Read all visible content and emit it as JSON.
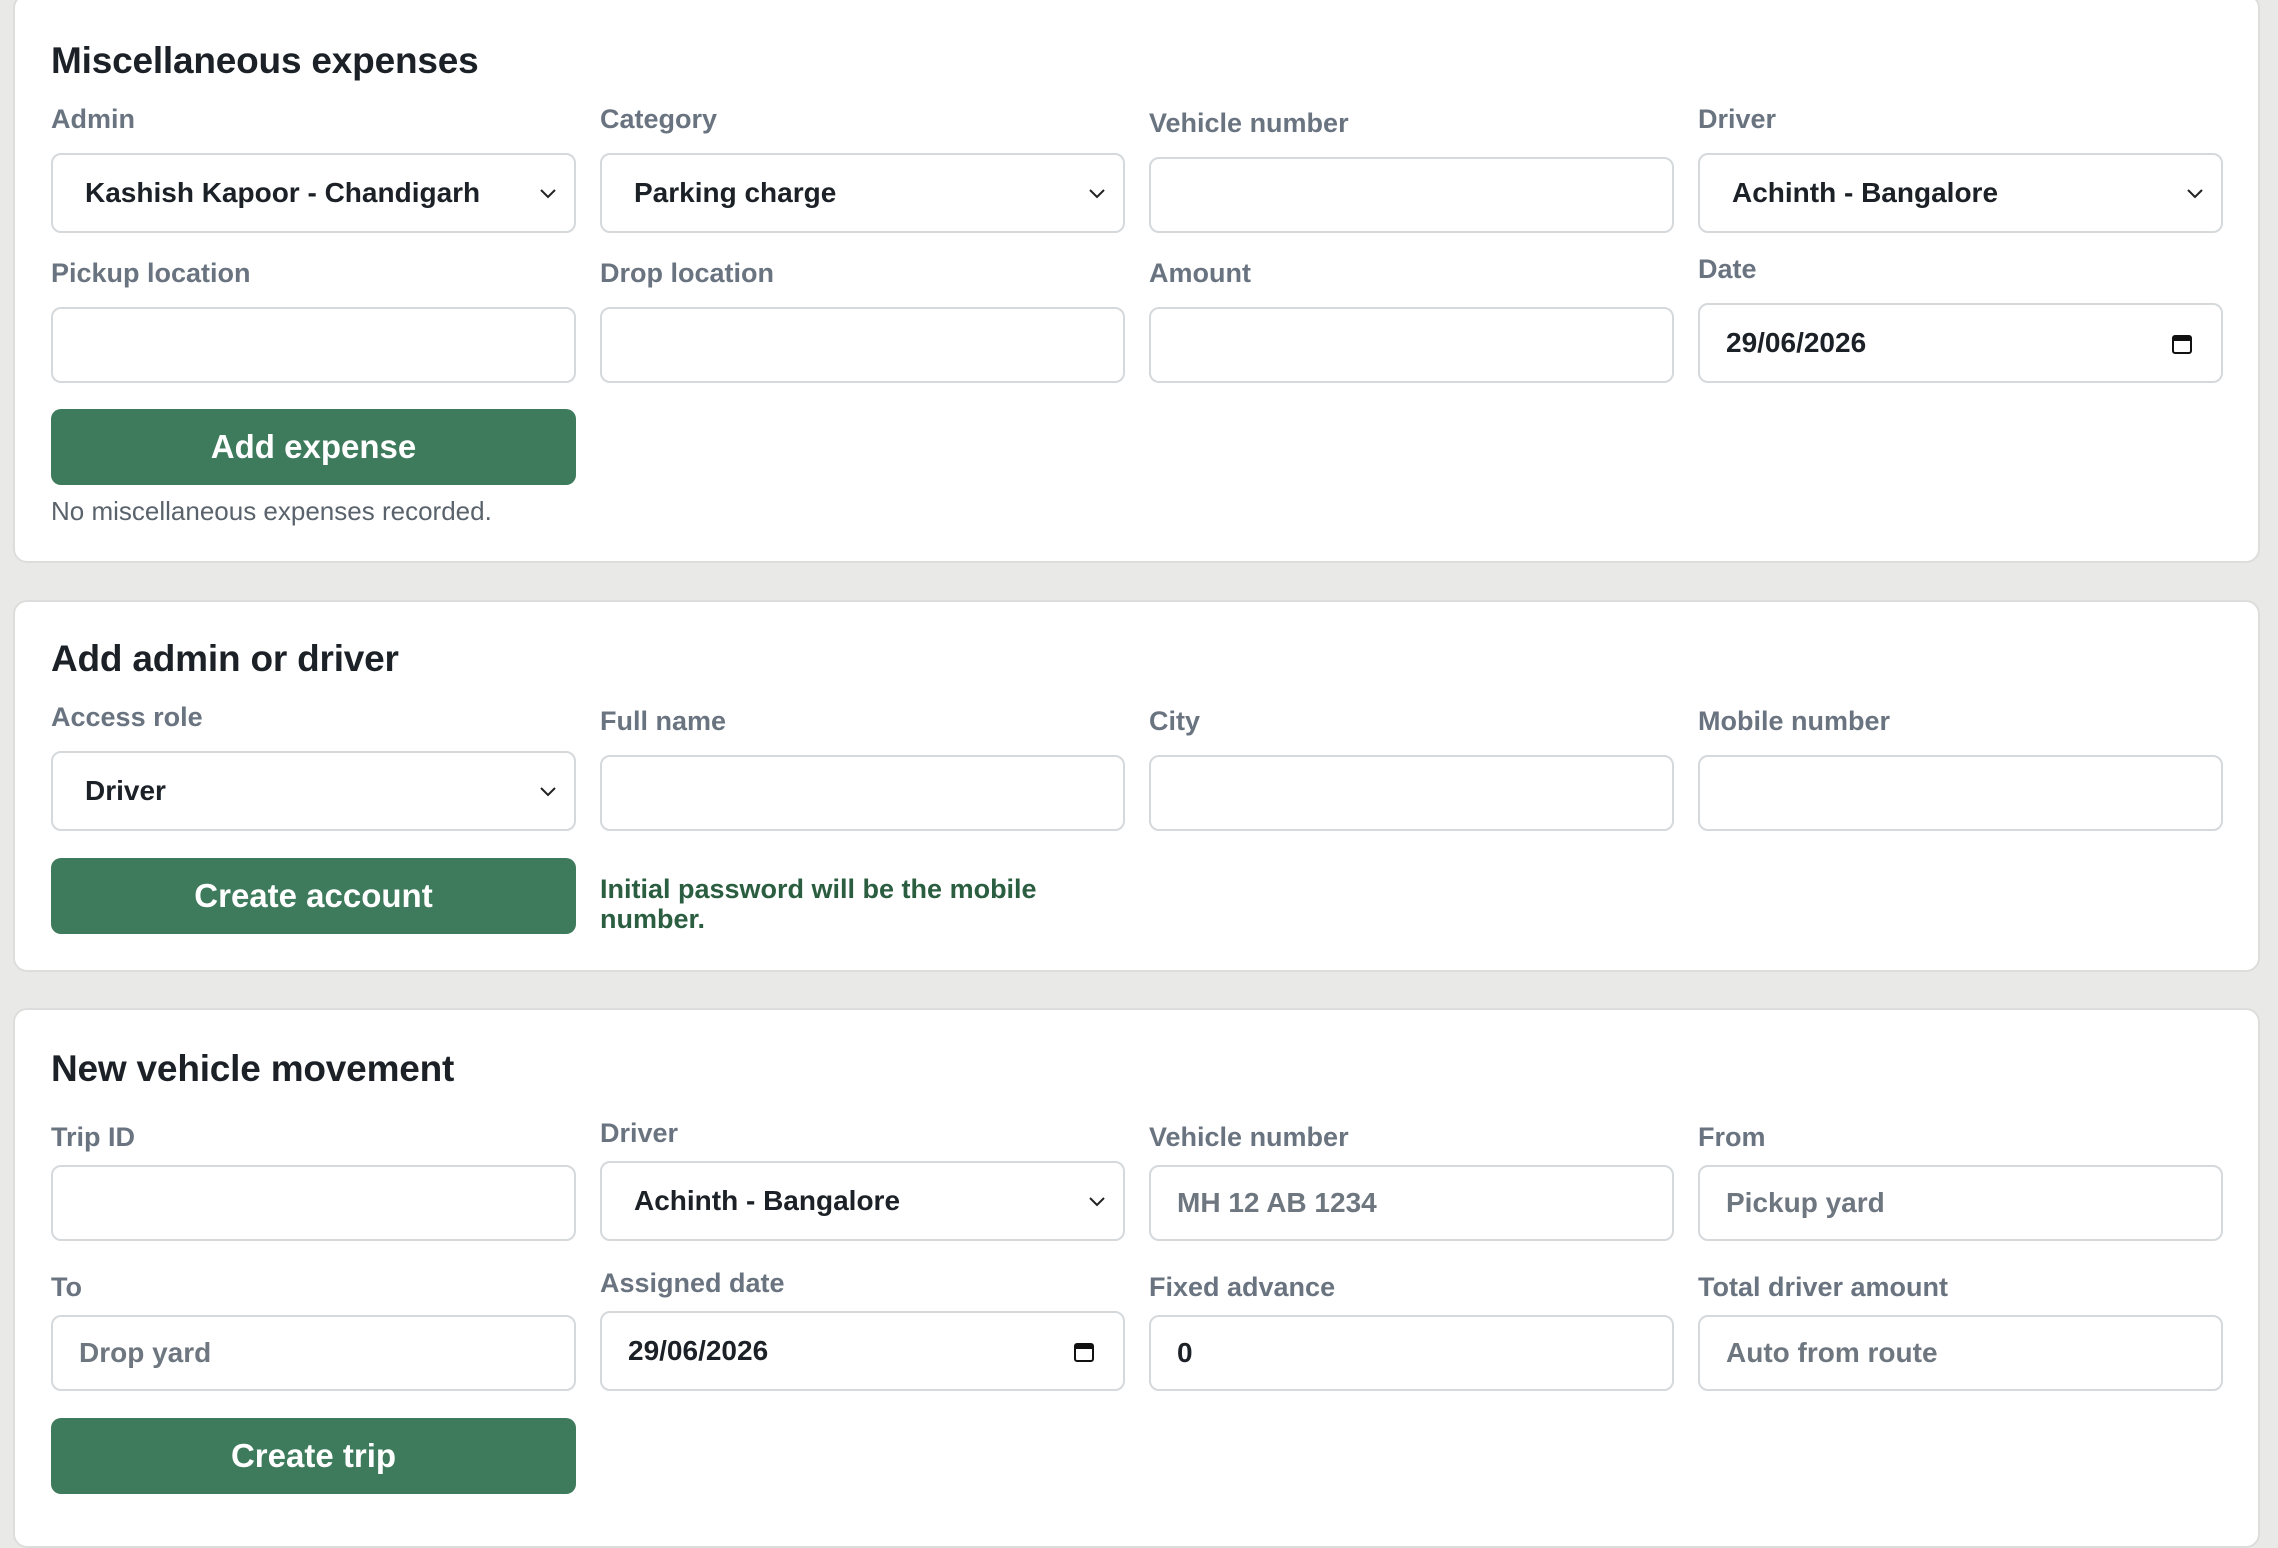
{
  "misc": {
    "title": "Miscellaneous expenses",
    "admin_label": "Admin",
    "admin_value": "Kashish Kapoor - Chandigarh",
    "category_label": "Category",
    "category_value": "Parking charge",
    "vehicle_label": "Vehicle number",
    "vehicle_value": "",
    "driver_label": "Driver",
    "driver_value": "Achinth - Bangalore",
    "pickup_label": "Pickup location",
    "pickup_value": "",
    "drop_label": "Drop location",
    "drop_value": "",
    "amount_label": "Amount",
    "amount_value": "",
    "date_label": "Date",
    "date_value": "29/06/2026",
    "add_button": "Add expense",
    "empty_note": "No miscellaneous expenses recorded."
  },
  "account": {
    "title": "Add admin or driver",
    "role_label": "Access role",
    "role_value": "Driver",
    "name_label": "Full name",
    "name_value": "",
    "city_label": "City",
    "city_value": "",
    "mobile_label": "Mobile number",
    "mobile_value": "",
    "create_button": "Create account",
    "password_hint": "Initial password will be the mobile number."
  },
  "trip": {
    "title": "New vehicle movement",
    "trip_id_label": "Trip ID",
    "trip_id_value": "",
    "driver_label": "Driver",
    "driver_value": "Achinth - Bangalore",
    "vehicle_label": "Vehicle number",
    "vehicle_placeholder": "MH 12 AB 1234",
    "from_label": "From",
    "from_placeholder": "Pickup yard",
    "to_label": "To",
    "to_placeholder": "Drop yard",
    "assigned_label": "Assigned date",
    "assigned_value": "29/06/2026",
    "advance_label": "Fixed advance",
    "advance_value": "0",
    "total_label": "Total driver amount",
    "total_placeholder": "Auto from route",
    "create_button": "Create trip"
  },
  "colors": {
    "accent": "#3e7b5c",
    "hint_text": "#2b5e41",
    "label_text": "#6a7480",
    "page_bg": "#e9eae8"
  },
  "icons": {
    "select_indicator": "chevron-down-icon",
    "date_picker": "calendar-icon"
  }
}
